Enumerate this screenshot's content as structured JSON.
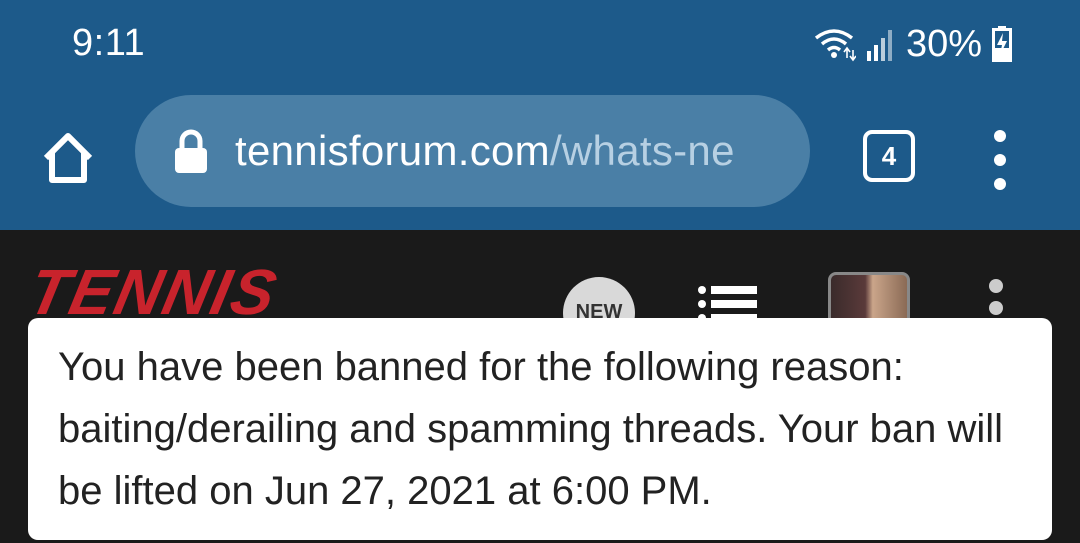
{
  "status_bar": {
    "time": "9:11",
    "battery": "30%"
  },
  "browser": {
    "url_domain": "tennisforum.com",
    "url_path": "/whats-ne",
    "tab_count": "4"
  },
  "site": {
    "logo": "TENNIS",
    "new_badge": "NEW"
  },
  "toast": {
    "message": "You have been banned for the following reason: baiting/derailing and spamming threads. Your ban will be lifted on Jun 27, 2021 at 6:00 PM."
  },
  "colors": {
    "browser_chrome": "#1d5a8a",
    "urlbar": "#4a7fa6",
    "logo_red": "#c8232c",
    "site_bg": "#1a1a1a"
  }
}
